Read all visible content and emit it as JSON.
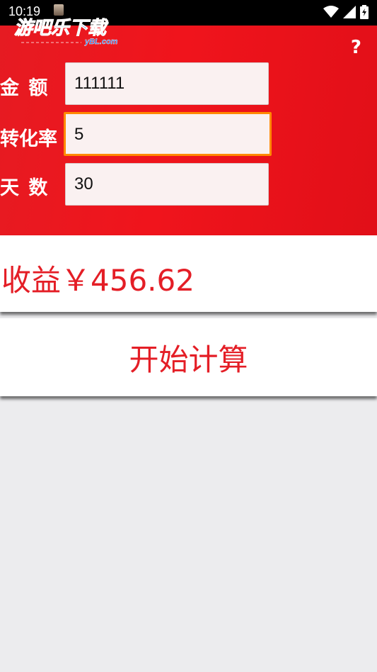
{
  "status_bar": {
    "time": "10:19",
    "icons": [
      "photo-thumbnail-icon",
      "wifi-icon",
      "signal-icon",
      "battery-icon"
    ]
  },
  "watermark": {
    "logo_text": "游吧乐下载",
    "logo_url_text": "yBL.com"
  },
  "header": {
    "help_label": "?",
    "fields": [
      {
        "label": "金 额",
        "value": "111111"
      },
      {
        "label": "转化率",
        "value": "5"
      },
      {
        "label": "天 数",
        "value": "30"
      }
    ]
  },
  "result": {
    "text": "收益￥456.62"
  },
  "action": {
    "calculate_label": "开始计算"
  },
  "colors": {
    "header_red": "#ee141c",
    "accent_red": "#e41e26",
    "focus_orange": "#ff8a00",
    "background": "#ececee"
  }
}
